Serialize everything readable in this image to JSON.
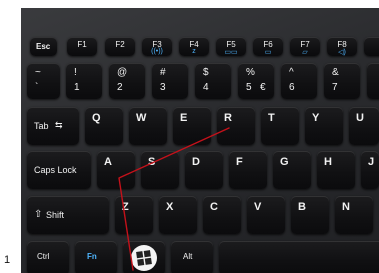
{
  "figure_number": "1",
  "colors": {
    "keyboard": "#2b2c2f",
    "key": "#111113",
    "key_text": "#f2f2f2",
    "fn_blue": "#4fb6ff",
    "trace": "#c4111a"
  },
  "keys": {
    "esc": "Esc",
    "f1": "F1",
    "f2": "F2",
    "f3": "F3",
    "f4": "F4",
    "f5": "F5",
    "f6": "F6",
    "f7": "F7",
    "f8": "F8",
    "tilde_top": "~",
    "tilde_bot": "`",
    "k1_top": "!",
    "k1": "1",
    "k2_top": "@",
    "k2": "2",
    "k3_top": "#",
    "k3": "3",
    "k4_top": "$",
    "k4": "4",
    "k5_top": "%",
    "k5": "5",
    "k5_alt": "€",
    "k6_top": "^",
    "k6": "6",
    "k7_top": "&",
    "k7": "7",
    "tab": "Tab",
    "q": "Q",
    "w": "W",
    "e": "E",
    "r": "R",
    "t": "T",
    "y": "Y",
    "u": "U",
    "caps": "Caps Lock",
    "a": "A",
    "s": "S",
    "d": "D",
    "f": "F",
    "g": "G",
    "h": "H",
    "j": "J",
    "shift": "Shift",
    "z": "Z",
    "x": "X",
    "c": "C",
    "v": "V",
    "b": "B",
    "n": "N",
    "ctrl": "Ctrl",
    "fn": "Fn",
    "alt": "Alt"
  },
  "icons": {
    "tab_arrows": "tab-arrows-icon",
    "shift_arrow": "shift-arrow-icon",
    "windows_logo": "windows-logo-icon"
  }
}
